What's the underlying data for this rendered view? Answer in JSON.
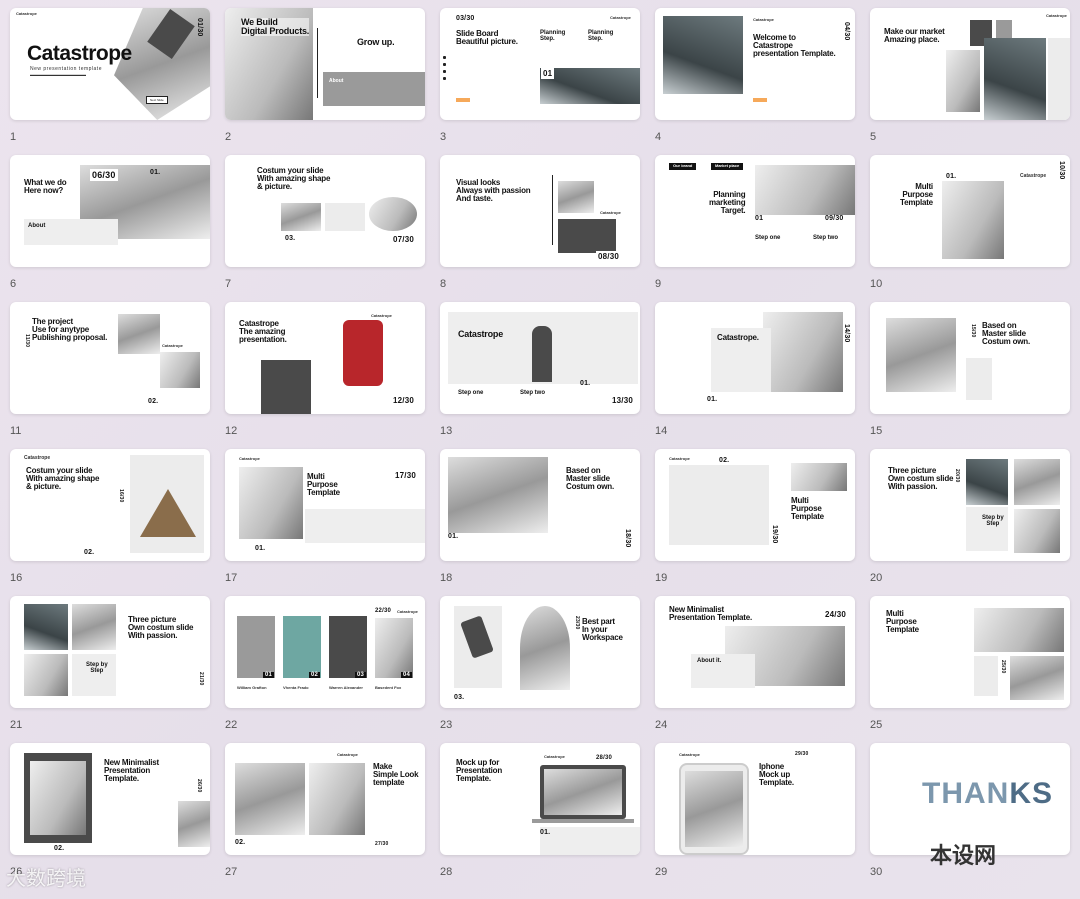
{
  "slides": [
    {
      "num": "1",
      "title": "Catastrope",
      "subtitle": "New presentation template",
      "brand": "Catastrope",
      "counter": "01/30",
      "button": "Next Slide"
    },
    {
      "num": "2",
      "title": "We Build\nDigital Products.",
      "subtitle": "Grow up.",
      "small": "About"
    },
    {
      "num": "3",
      "title": "Slide Board\nBeautiful picture.",
      "counter": "03/30",
      "subtitle": "Planning\nStep.",
      "subtitle2": "Planning\nStep.",
      "brand": "Catastrope",
      "box": "01"
    },
    {
      "num": "4",
      "title": "Welcome to\nCatastrope\npresentation Template.",
      "brand": "Catastrope",
      "counter": "04/30"
    },
    {
      "num": "5",
      "title": "Make our market\nAmazing place.",
      "brand": "Catastrope"
    },
    {
      "num": "6",
      "title": "What we do\nHere now?",
      "counter": "06/30",
      "small": "About",
      "box": "01."
    },
    {
      "num": "7",
      "title": "Costum your slide\nWith amazing shape\n& picture.",
      "counter": "07/30",
      "box": "03."
    },
    {
      "num": "8",
      "title": "Visual looks\nAlways with passion\nAnd taste.",
      "counter": "08/30",
      "brand": "Catastrope"
    },
    {
      "num": "9",
      "title": "Planning\nmarketing\nTarget.",
      "counter": "09/30",
      "tag1": "Our brand",
      "tag2": "Market place",
      "step1": "Step one",
      "step2": "Step two",
      "box": "01"
    },
    {
      "num": "10",
      "title": "Multi\nPurpose\nTemplate",
      "brand": "Catastrope",
      "counter": "10/30",
      "box": "01."
    },
    {
      "num": "11",
      "title": "The project\nUse for anytype\nPublishing proposal.",
      "brand": "Catastrope",
      "counter": "11/30",
      "box": "02."
    },
    {
      "num": "12",
      "title": "Catastrope\nThe amazing\npresentation.",
      "brand": "Catastrope",
      "counter": "12/30"
    },
    {
      "num": "13",
      "title": "Catastrope",
      "counter": "13/30",
      "step1": "Step one",
      "step2": "Step two",
      "box": "01."
    },
    {
      "num": "14",
      "title": "Catastrope.",
      "counter": "14/30",
      "box": "01."
    },
    {
      "num": "15",
      "title": "Based on\nMaster slide\nCostum own.",
      "counter": "15/30"
    },
    {
      "num": "16",
      "title": "Costum your slide\nWith amazing shape\n& picture.",
      "brand": "Catastrope",
      "counter": "16/30",
      "box": "02."
    },
    {
      "num": "17",
      "title": "Multi\nPurpose\nTemplate",
      "brand": "Catastrope",
      "counter": "17/30",
      "box": "01."
    },
    {
      "num": "18",
      "title": "Based on\nMaster slide\nCostum own.",
      "counter": "18/30",
      "box": "01."
    },
    {
      "num": "19",
      "title": "Multi\nPurpose\nTemplate",
      "brand": "Catastrope",
      "counter": "19/30",
      "box": "02."
    },
    {
      "num": "20",
      "title": "Three picture\nOwn costum slide\nWith passion.",
      "counter": "20/30",
      "step": "Step by\nStep"
    },
    {
      "num": "21",
      "title": "Three picture\nOwn costum slide\nWith passion.",
      "counter": "21/30",
      "step": "Step by\nStep"
    },
    {
      "num": "22",
      "counter": "22/30",
      "brand": "Catastrope",
      "labels": [
        "01",
        "02",
        "03",
        "04"
      ],
      "names": [
        "William Grafton",
        "Vhenta Frado",
        "Warren Alexander",
        "Basedent Fox"
      ]
    },
    {
      "num": "23",
      "title": "Best part\nIn your\nWorkspace",
      "counter": "23/30",
      "box": "03."
    },
    {
      "num": "24",
      "title": "New Minimalist\nPresentation Template.",
      "counter": "24/30",
      "small": "About it."
    },
    {
      "num": "25",
      "title": "Multi\nPurpose\nTemplate",
      "counter": "25/30"
    },
    {
      "num": "26",
      "title": "New Minimalist\nPresentation\nTemplate.",
      "counter": "26/30",
      "box": "02."
    },
    {
      "num": "27",
      "title": "Make\nSimple Look\ntemplate",
      "brand": "Catastrope",
      "counter": "27/30",
      "box": "02."
    },
    {
      "num": "28",
      "title": "Mock up for\nPresentation\nTemplate.",
      "brand": "Catastrope",
      "counter": "28/30",
      "box": "01."
    },
    {
      "num": "29",
      "title": "Iphone\nMock up\nTemplate.",
      "brand": "Catastrope",
      "counter": "29/30"
    },
    {
      "num": "30",
      "thanks_a": "THAN",
      "thanks_b": "KS"
    }
  ],
  "watermarks": {
    "bottom_left": "大数跨境",
    "bottom_right": "本设网"
  },
  "colors": {
    "background": "#e9e3ec",
    "slide": "#ffffff",
    "accent": "#f6a95a",
    "thanks": "#4e6c86"
  }
}
